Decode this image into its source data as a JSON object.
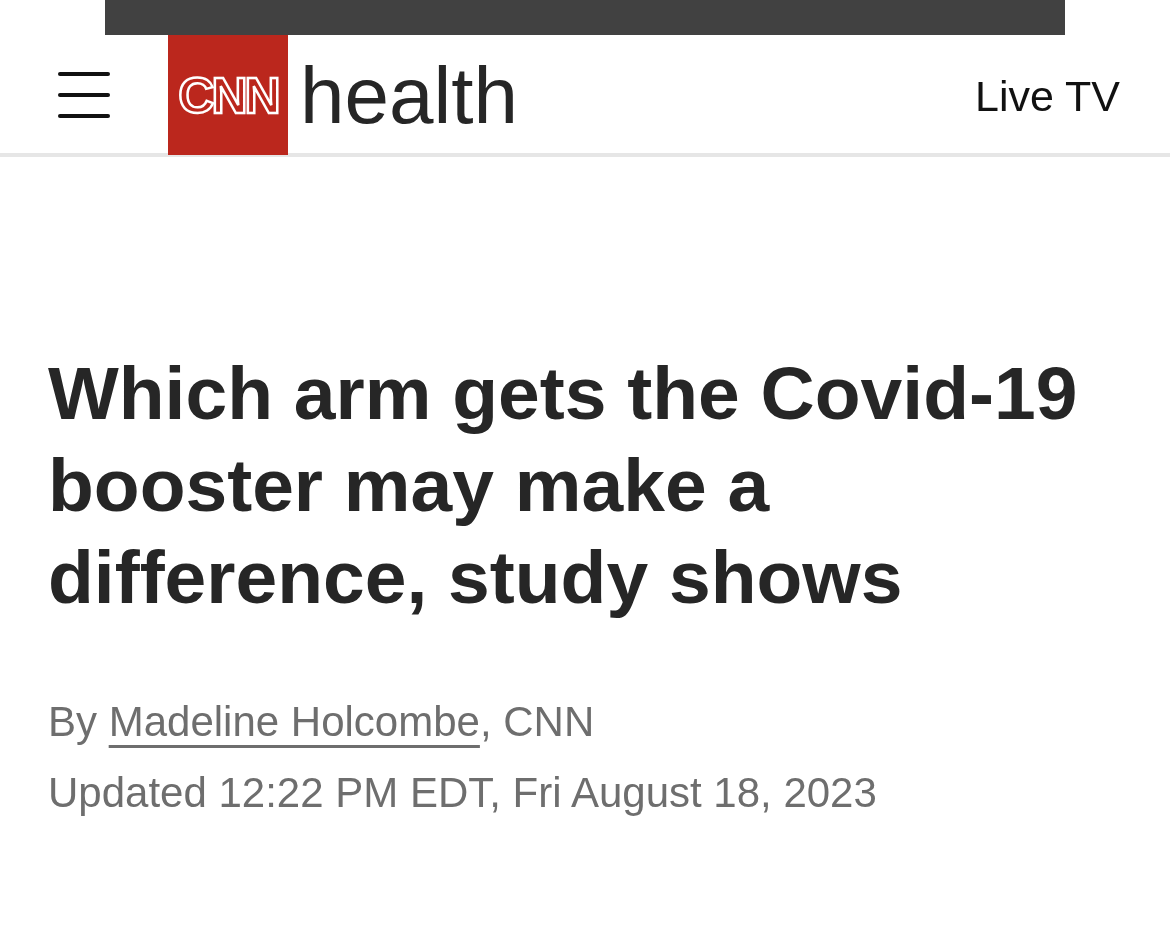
{
  "header": {
    "logo_text": "CNN",
    "section": "health",
    "live_link": "Live TV"
  },
  "article": {
    "headline": "Which arm gets the Covid-19 booster may make a difference, study shows",
    "byline": {
      "prefix": "By",
      "author": "Madeline Holcombe",
      "suffix": ", CNN"
    },
    "updated": "Updated 12:22 PM EDT, Fri August 18, 2023"
  }
}
